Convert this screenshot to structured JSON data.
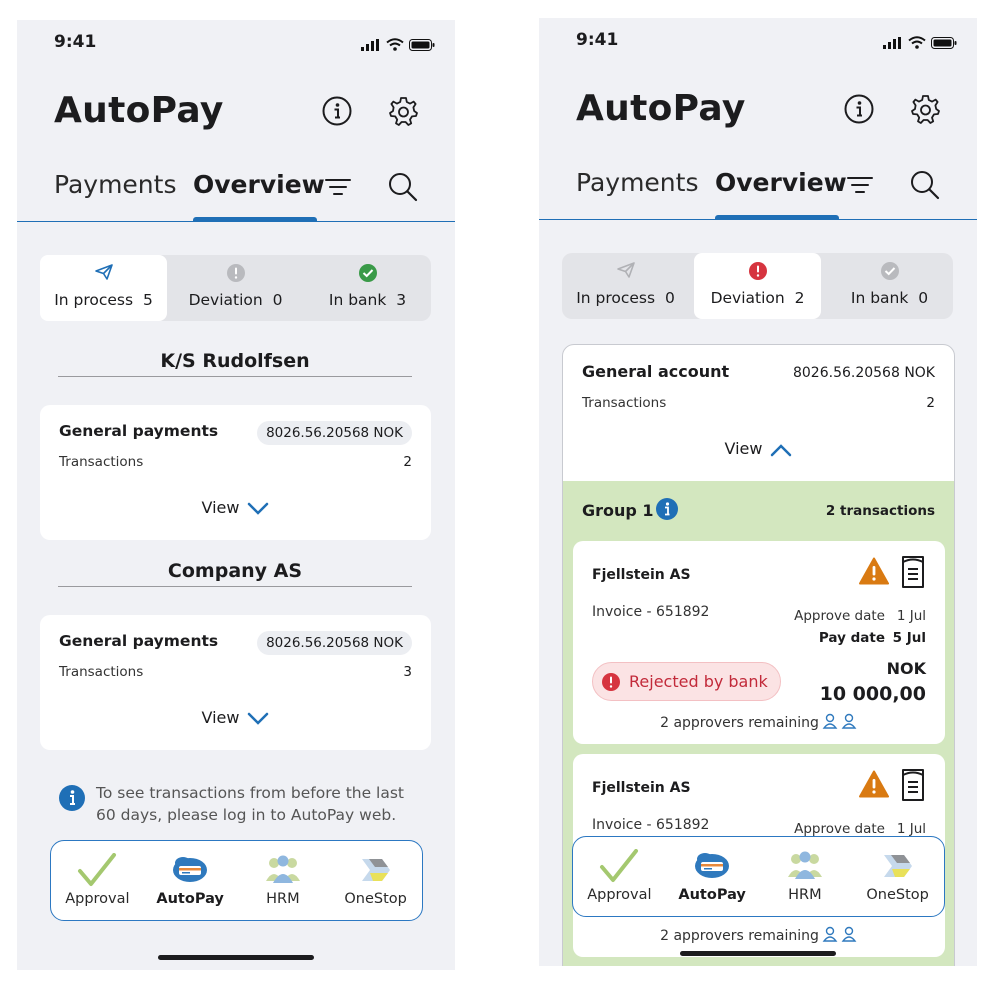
{
  "common": {
    "time": "9:41",
    "app_title": "AutoPay",
    "tabs": {
      "payments": "Payments",
      "overview": "Overview"
    },
    "nav": [
      {
        "label": "Approval"
      },
      {
        "label": "AutoPay"
      },
      {
        "label": "HRM"
      },
      {
        "label": "OneStop"
      }
    ],
    "colors": {
      "accent": "#1f6fb6",
      "success": "#3a9a48",
      "danger": "#d6343f",
      "warning": "#d97a12",
      "group_bg": "#d3e7bf"
    }
  },
  "left": {
    "status_tabs": [
      {
        "label": "In process",
        "count": "5",
        "icon": "paper-plane-icon",
        "active": true
      },
      {
        "label": "Deviation",
        "count": "0",
        "icon": "exclamation-circle-icon",
        "active": false
      },
      {
        "label": "In bank",
        "count": "3",
        "icon": "check-circle-icon",
        "active": false
      }
    ],
    "companies": [
      {
        "name": "K/S Rudolfsen",
        "card": {
          "name": "General payments",
          "account": "8026.56.20568 NOK",
          "tx_label": "Transactions",
          "tx_count": "2",
          "view": "View"
        }
      },
      {
        "name": "Company AS",
        "card": {
          "name": "General payments",
          "account": "8026.56.20568 NOK",
          "tx_label": "Transactions",
          "tx_count": "3",
          "view": "View"
        }
      }
    ],
    "info_line1": "To see transactions from before the last",
    "info_line2": "60 days, please log in to AutoPay web."
  },
  "right": {
    "status_tabs": [
      {
        "label": "In process",
        "count": "0",
        "icon": "paper-plane-icon",
        "active": false
      },
      {
        "label": "Deviation",
        "count": "2",
        "icon": "exclamation-circle-icon",
        "active": true
      },
      {
        "label": "In bank",
        "count": "0",
        "icon": "check-circle-icon",
        "active": false
      }
    ],
    "account": {
      "name": "General account",
      "number": "8026.56.20568 NOK",
      "tx_label": "Transactions",
      "tx_count": "2",
      "view": "View"
    },
    "group": {
      "title": "Group 1",
      "count": "2 transactions"
    },
    "invoices": [
      {
        "payee": "Fjellstein AS",
        "invoice": "Invoice - 651892",
        "approve_label": "Approve date",
        "approve_value": "1 Jul",
        "pay_label": "Pay date",
        "pay_value": "5 Jul",
        "currency": "NOK",
        "amount": "10 000,00",
        "status": "Rejected by bank",
        "approvers": "2 approvers remaining"
      },
      {
        "payee": "Fjellstein AS",
        "invoice": "Invoice - 651892",
        "approve_label": "Approve date",
        "approve_value": "1 Jul",
        "approvers": "2 approvers remaining"
      }
    ]
  }
}
